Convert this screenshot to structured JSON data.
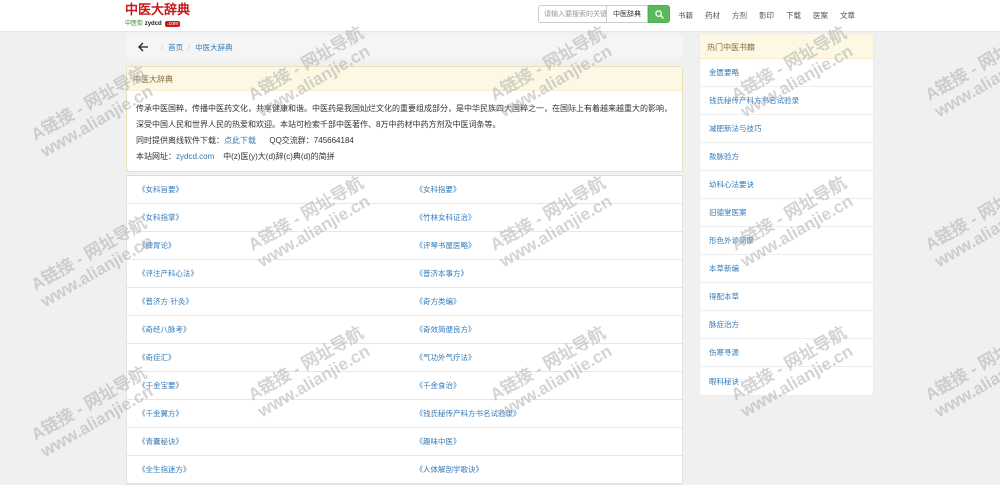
{
  "logo": {
    "title": "中医大辞典",
    "sub_green": "中医街",
    "sub_domain": "zydcd",
    "sub_badge": ".com"
  },
  "search": {
    "placeholder": "请输入要搜索的关键字",
    "select_value": "中医辞典",
    "button_icon": "search-icon"
  },
  "nav": [
    "书籍",
    "药材",
    "方剂",
    "影印",
    "下载",
    "医案",
    "文章"
  ],
  "breadcrumb": {
    "back_icon": "arrow-left-icon",
    "home": "首页",
    "current": "中医大辞典"
  },
  "panel": {
    "title": "中医大辞典",
    "intro": "传承中医国粹，传播中医药文化，共享健康和谐。中医药是我国灿烂文化的重要组成部分，是中华民族四大国粹之一，在国际上有着越来越重大的影响，深受中国人民和世界人民的热爱和欢迎。本站可检索千部中医著作、8万中药材中药方剂及中医词条等。",
    "download_label": "同时提供离线软件下载：",
    "download_link": "点此下载",
    "qq_label": "QQ交流群：",
    "qq_number": "745664184",
    "site_label": "本站网址：",
    "site_url": "zydcd.com",
    "site_note": "中(z)医(y)大(d)辞(c)典(d)的简拼"
  },
  "books": [
    [
      "《女科旨要》",
      "《女科指要》"
    ],
    [
      "《女科指掌》",
      "《竹林女科证治》"
    ],
    [
      "《脾胃论》",
      "《评琴书屋医略》"
    ],
    [
      "《评注产科心法》",
      "《普济本事方》"
    ],
    [
      "《普济方·针灸》",
      "《奇方类编》"
    ],
    [
      "《奇经八脉考》",
      "《奇效简便良方》"
    ],
    [
      "《奇症汇》",
      "《气功外气疗法》"
    ],
    [
      "《千金宝要》",
      "《千金食治》"
    ],
    [
      "《千金翼方》",
      "《钱氏秘传产科方书名试验录》"
    ],
    [
      "《青囊秘诀》",
      "《趣味中医》"
    ],
    [
      "《全生指迷方》",
      "《人体解剖学歌诀》"
    ]
  ],
  "sidebar": {
    "title": "热门中医书籍",
    "items": [
      "金匮要略",
      "钱氏秘传产科方书名试验录",
      "减肥新法与技巧",
      "敖脉验方",
      "幼科心法要诀",
      "旧德堂医案",
      "形色外诊简摩",
      "本草新编",
      "得配本草",
      "脉症治方",
      "伤寒寻源",
      "眼科秘诀"
    ]
  },
  "watermark": {
    "line1": "A链接 - 网址导航",
    "line2": "www.alianjie.cn"
  }
}
